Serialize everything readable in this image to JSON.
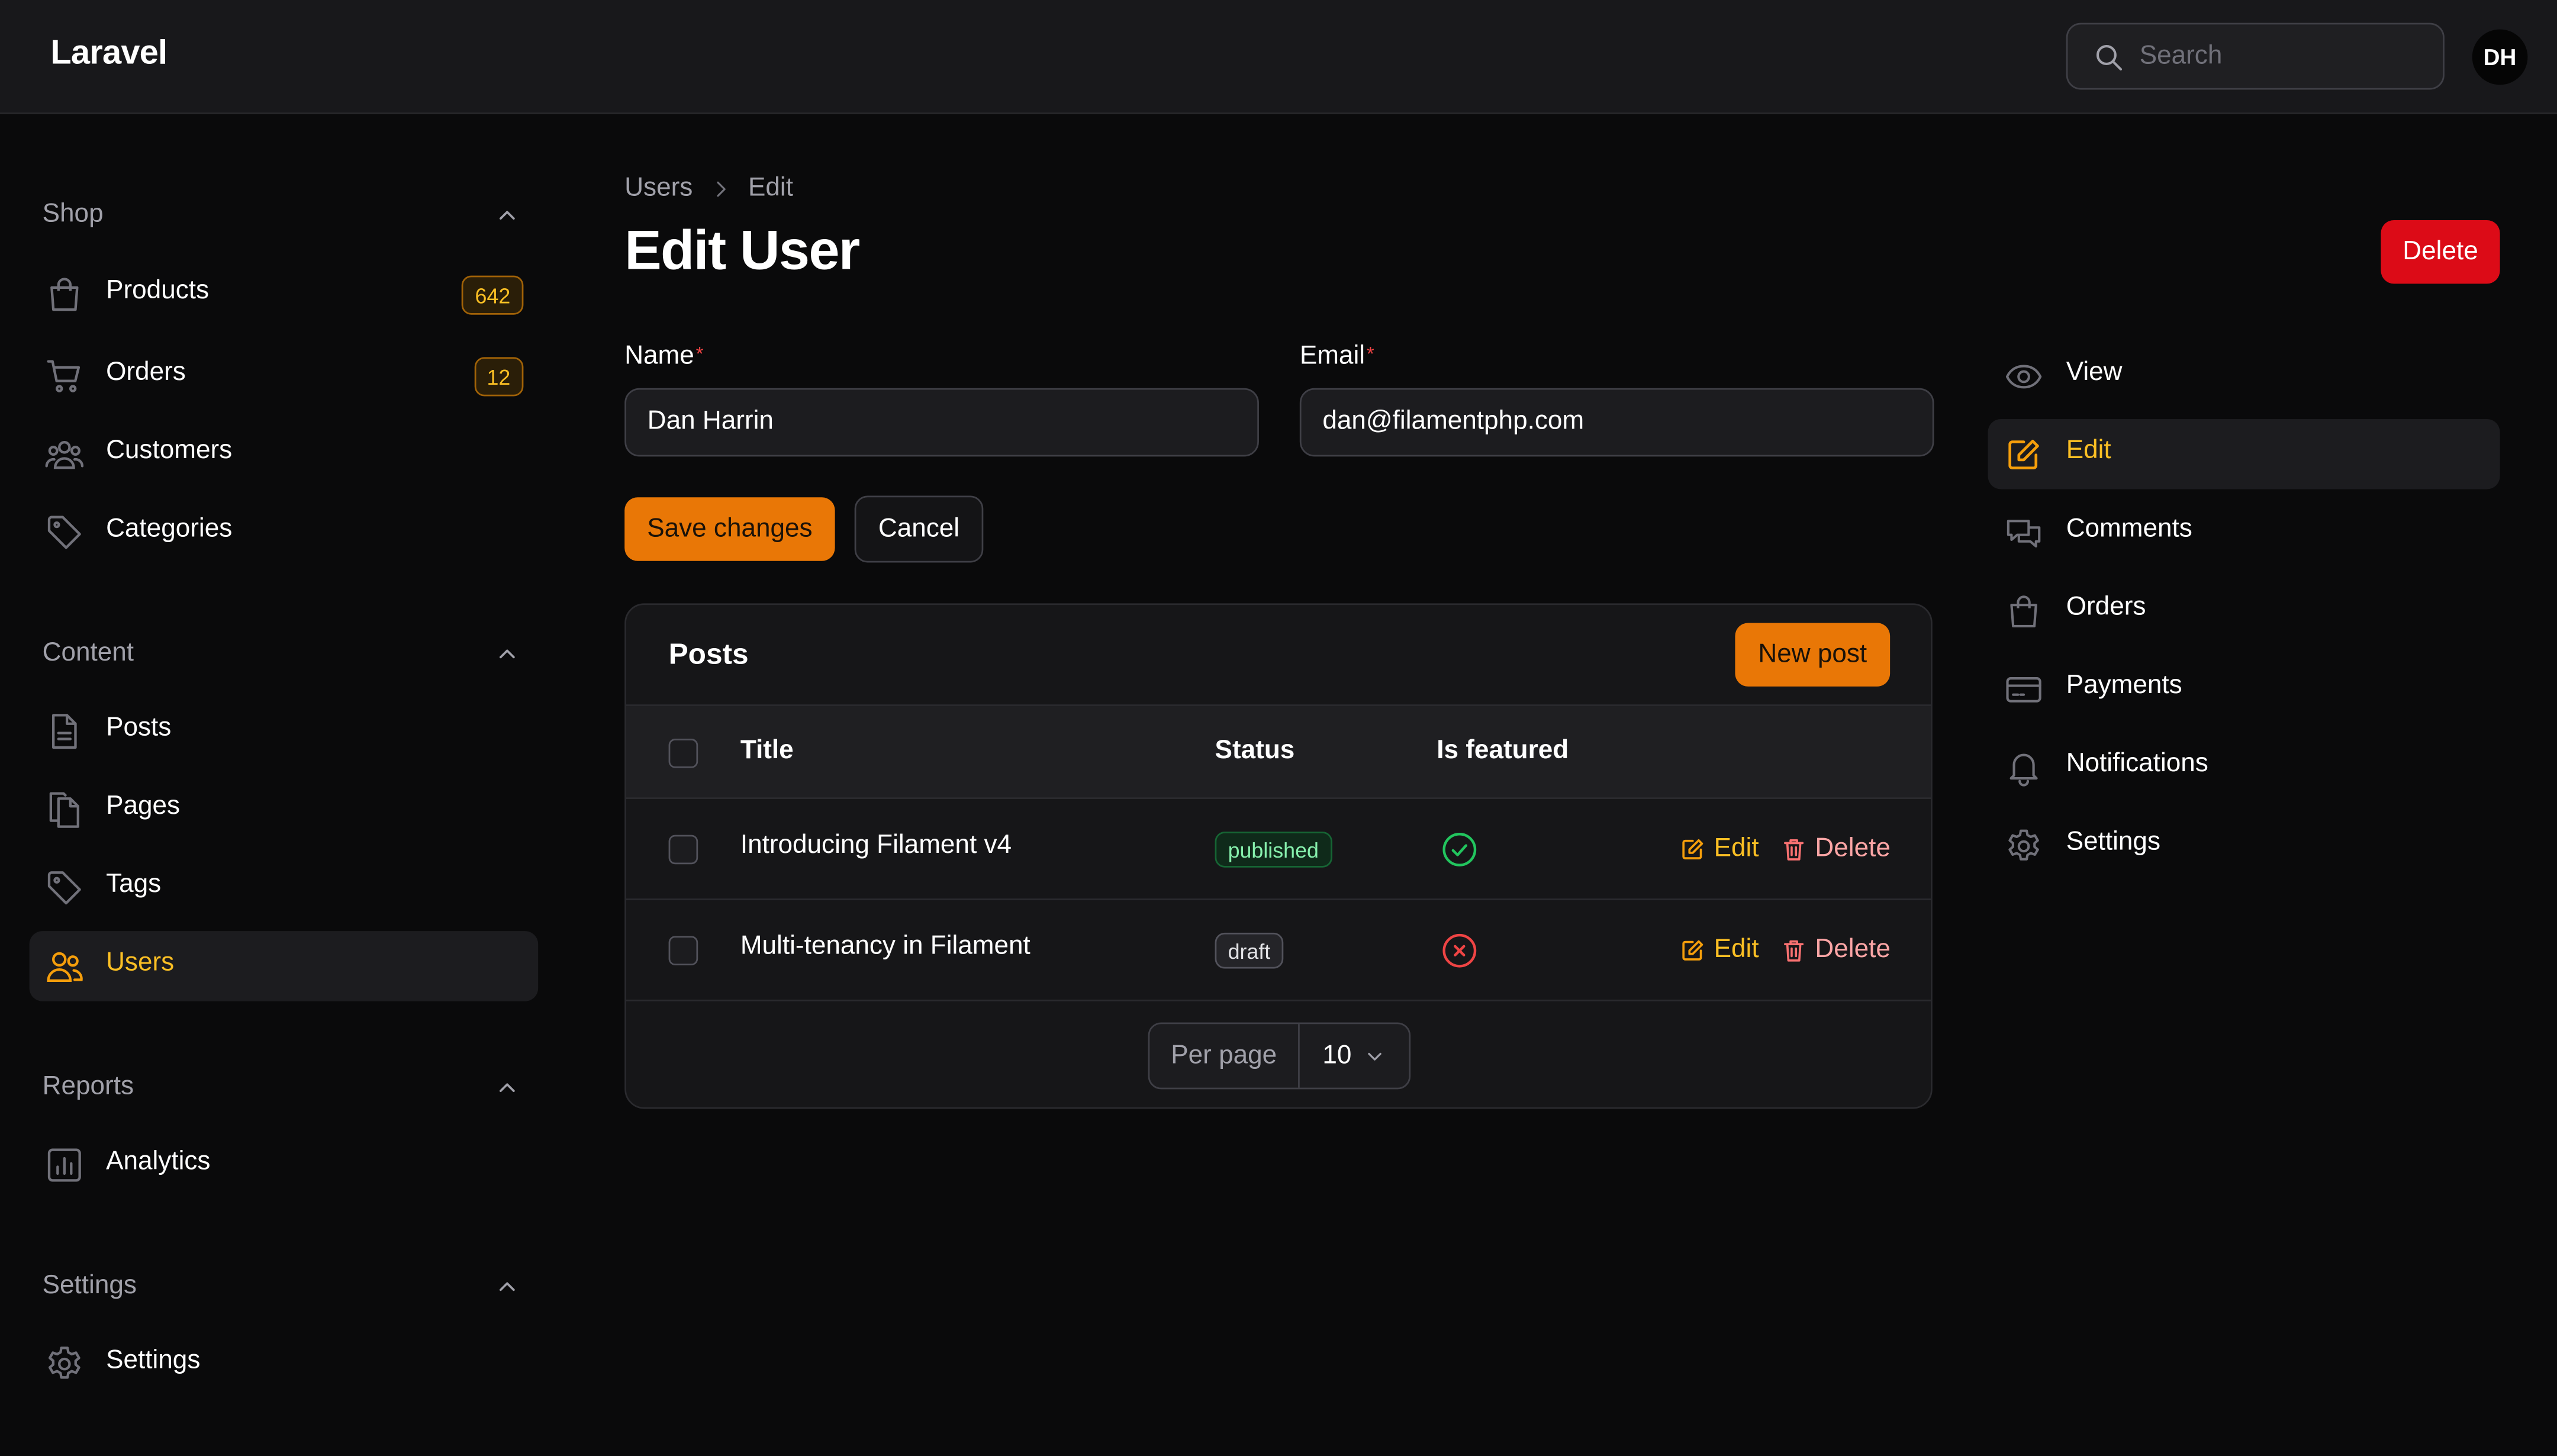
{
  "app": {
    "brand": "Laravel"
  },
  "topbar": {
    "search_placeholder": "Search",
    "avatar_initials": "DH"
  },
  "sidebar": {
    "groups": [
      {
        "label": "Shop",
        "items": [
          {
            "label": "Products",
            "icon": "shopping-bag-icon",
            "badge": "642"
          },
          {
            "label": "Orders",
            "icon": "shopping-cart-icon",
            "badge": "12"
          },
          {
            "label": "Customers",
            "icon": "user-group-icon"
          },
          {
            "label": "Categories",
            "icon": "tag-icon"
          }
        ]
      },
      {
        "label": "Content",
        "items": [
          {
            "label": "Posts",
            "icon": "document-icon"
          },
          {
            "label": "Pages",
            "icon": "documents-icon"
          },
          {
            "label": "Tags",
            "icon": "tag-icon"
          },
          {
            "label": "Users",
            "icon": "users-icon",
            "active": true
          }
        ]
      },
      {
        "label": "Reports",
        "items": [
          {
            "label": "Analytics",
            "icon": "chart-bar-icon"
          }
        ]
      },
      {
        "label": "Settings",
        "items": [
          {
            "label": "Settings",
            "icon": "cog-icon"
          }
        ]
      }
    ]
  },
  "breadcrumb": [
    "Users",
    "Edit"
  ],
  "page": {
    "title": "Edit User",
    "delete_label": "Delete"
  },
  "form": {
    "name": {
      "label": "Name",
      "required_mark": "*",
      "value": "Dan Harrin"
    },
    "email": {
      "label": "Email",
      "required_mark": "*",
      "value": "dan@filamentphp.com"
    },
    "save_label": "Save changes",
    "cancel_label": "Cancel"
  },
  "posts": {
    "title": "Posts",
    "new_label": "New post",
    "columns": [
      "Title",
      "Status",
      "Is featured"
    ],
    "rows": [
      {
        "title": "Introducing Filament v4",
        "status": "published",
        "status_color": "#86efac",
        "featured": true
      },
      {
        "title": "Multi-tenancy in Filament",
        "status": "draft",
        "status_color": "#e4e4e7",
        "featured": false
      }
    ],
    "row_edit_label": "Edit",
    "row_delete_label": "Delete",
    "per_page_label": "Per page",
    "per_page_value": "10"
  },
  "subnav": [
    {
      "label": "View",
      "icon": "eye-icon"
    },
    {
      "label": "Edit",
      "icon": "pencil-square-icon",
      "active": true
    },
    {
      "label": "Comments",
      "icon": "chat-bubbles-icon"
    },
    {
      "label": "Orders",
      "icon": "shopping-bag-icon"
    },
    {
      "label": "Payments",
      "icon": "credit-card-icon"
    },
    {
      "label": "Notifications",
      "icon": "bell-icon"
    },
    {
      "label": "Settings",
      "icon": "cog-icon"
    }
  ],
  "colors": {
    "accent": "#f59e0b",
    "primary_button": "#e97706",
    "danger": "#dc0b17",
    "background": "#0a0a0b",
    "surface": "#18181b"
  }
}
